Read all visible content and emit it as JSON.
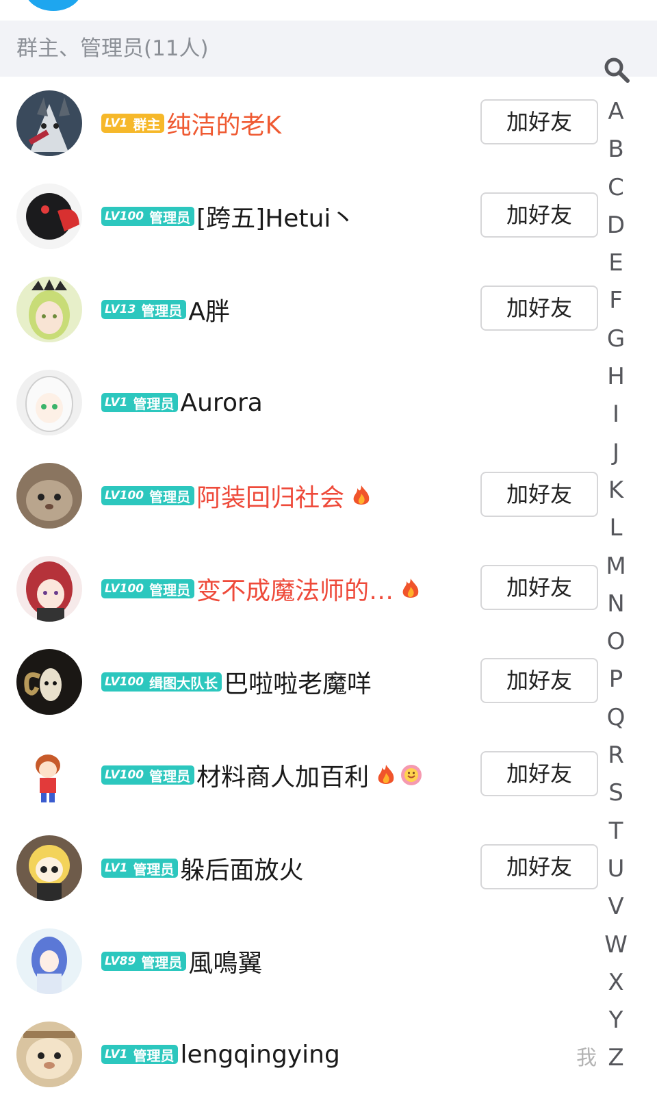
{
  "section_header": "群主、管理员(11人)",
  "add_friend_label": "加好友",
  "index_letters": [
    "A",
    "B",
    "C",
    "D",
    "E",
    "F",
    "G",
    "H",
    "I",
    "J",
    "K",
    "L",
    "M",
    "N",
    "O",
    "P",
    "Q",
    "R",
    "S",
    "T",
    "U",
    "V",
    "W",
    "X",
    "Y",
    "Z"
  ],
  "members": [
    {
      "lv": "LV1",
      "role": "群主",
      "role_type": "owner",
      "name": "纯洁的老K",
      "name_color": "orange",
      "button": "加好友",
      "avatar": "wolf"
    },
    {
      "lv": "LV100",
      "role": "管理员",
      "role_type": "admin",
      "name": "[跨五]Hetui丶",
      "name_color": "default",
      "button": "加好友",
      "avatar": "dark-mask"
    },
    {
      "lv": "LV13",
      "role": "管理员",
      "role_type": "admin",
      "name": "A胖",
      "name_color": "default",
      "button": "加好友",
      "avatar": "anime-green"
    },
    {
      "lv": "LV1",
      "role": "管理员",
      "role_type": "admin",
      "name": "Aurora",
      "name_color": "default",
      "button": "",
      "avatar": "anime-white"
    },
    {
      "lv": "LV100",
      "role": "管理员",
      "role_type": "admin",
      "name": "阿装回归社会",
      "name_color": "red",
      "button": "加好友",
      "avatar": "cat",
      "emoji": [
        "fire-icon"
      ]
    },
    {
      "lv": "LV100",
      "role": "管理员",
      "role_type": "admin",
      "name": "变不成魔法师的…",
      "name_color": "red",
      "button": "加好友",
      "avatar": "anime-red",
      "emoji": [
        "fire-icon"
      ]
    },
    {
      "lv": "LV100",
      "role": "缉图大队长",
      "role_type": "leader",
      "name": "巴啦啦老魔咩",
      "name_color": "default",
      "button": "加好友",
      "avatar": "ram-skull"
    },
    {
      "lv": "LV100",
      "role": "管理员",
      "role_type": "admin",
      "name": "材料商人加百利",
      "name_color": "default",
      "button": "加好友",
      "avatar": "chibi-boy",
      "emoji": [
        "fire-icon",
        "smile-icon"
      ]
    },
    {
      "lv": "LV1",
      "role": "管理员",
      "role_type": "admin",
      "name": "躲后面放火",
      "name_color": "default",
      "button": "加好友",
      "avatar": "chibi-yellow"
    },
    {
      "lv": "LV89",
      "role": "管理员",
      "role_type": "admin",
      "name": "風鳴翼",
      "name_color": "default",
      "button": "",
      "avatar": "anime-blue"
    },
    {
      "lv": "LV1",
      "role": "管理员",
      "role_type": "admin",
      "name": "lengqingying",
      "name_color": "default",
      "button": "",
      "avatar": "cat2",
      "me": "我"
    }
  ],
  "colors": {
    "owner_badge": "#f6b82a",
    "admin_badge": "#2cc7be",
    "red_name": "#ee4a3a",
    "orange_name": "#ef5a32",
    "header_bg": "#f2f3f7"
  }
}
